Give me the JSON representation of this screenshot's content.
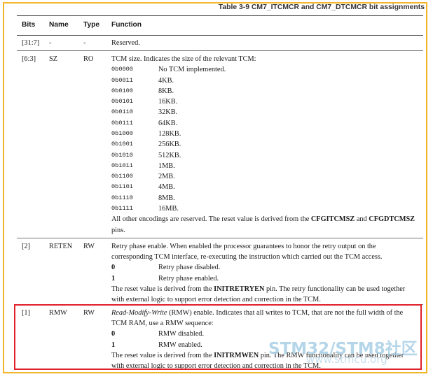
{
  "caption": "Table 3-9 CM7_ITCMCR and CM7_DTCMCR bit assignments",
  "headers": {
    "bits": "Bits",
    "name": "Name",
    "type": "Type",
    "function": "Function"
  },
  "rows": [
    {
      "bits": "[31:7]",
      "name": "-",
      "type": "-",
      "function": "Reserved."
    },
    {
      "bits": "[6:3]",
      "name": "SZ",
      "type": "RO",
      "function": "TCM size. Indicates the size of the relevant TCM:",
      "encodings": [
        {
          "code": "0b0000",
          "desc": "No TCM implemented."
        },
        {
          "code": "0b0011",
          "desc": "4KB."
        },
        {
          "code": "0b0100",
          "desc": "8KB."
        },
        {
          "code": "0b0101",
          "desc": "16KB."
        },
        {
          "code": "0b0110",
          "desc": "32KB."
        },
        {
          "code": "0b0111",
          "desc": "64KB."
        },
        {
          "code": "0b1000",
          "desc": "128KB."
        },
        {
          "code": "0b1001",
          "desc": "256KB."
        },
        {
          "code": "0b1010",
          "desc": "512KB."
        },
        {
          "code": "0b1011",
          "desc": "1MB."
        },
        {
          "code": "0b1100",
          "desc": "2MB."
        },
        {
          "code": "0b1101",
          "desc": "4MB."
        },
        {
          "code": "0b1110",
          "desc": "8MB."
        },
        {
          "code": "0b1111",
          "desc": "16MB."
        }
      ],
      "note_pre": "All other encodings are reserved. The reset value is derived from the ",
      "note_b1": "CFGITCMSZ",
      "note_mid": " and ",
      "note_b2": "CFGDTCMSZ",
      "note_post": "pins."
    },
    {
      "bits": "[2]",
      "name": "RETEN",
      "type": "RW",
      "line1": "Retry phase enable. When enabled the processor guarantees to honor the retry output on the",
      "line2": "corresponding TCM interface, re-executing the instruction which carried out the TCM access.",
      "opts": [
        {
          "code": "0",
          "desc": "Retry phase disabled."
        },
        {
          "code": "1",
          "desc": "Retry phase enabled."
        }
      ],
      "reset_pre": "The reset value is derived from the ",
      "reset_b": "INITRETRYEN",
      "reset_post": " pin. The retry functionality can be used together",
      "reset_line2": "with external logic to support error detection and correction in the TCM."
    },
    {
      "bits": "[1]",
      "name": "RMW",
      "type": "RW",
      "italic": "Read-Modify-Write",
      "line1_post": " (RMW) enable. Indicates that all writes to TCM, that are not the full width of the",
      "line2": "TCM RAM, use a RMW sequence:",
      "opts": [
        {
          "code": "0",
          "desc": "RMW disabled."
        },
        {
          "code": "1",
          "desc": "RMW enabled."
        }
      ],
      "reset_pre": "The reset value is derived from the ",
      "reset_b": "INITRMWEN",
      "reset_post": " pin. The RMW functionality can be used together",
      "reset_line2": "with external logic to support error detection and correction in the TCM."
    }
  ],
  "watermark": {
    "line1": "STM32/STM8社区",
    "line2": "www.stmcu.org"
  },
  "colors": {
    "frame": "#f3b52a",
    "highlight": "#e0202a",
    "watermark": "#a9cfe6"
  }
}
